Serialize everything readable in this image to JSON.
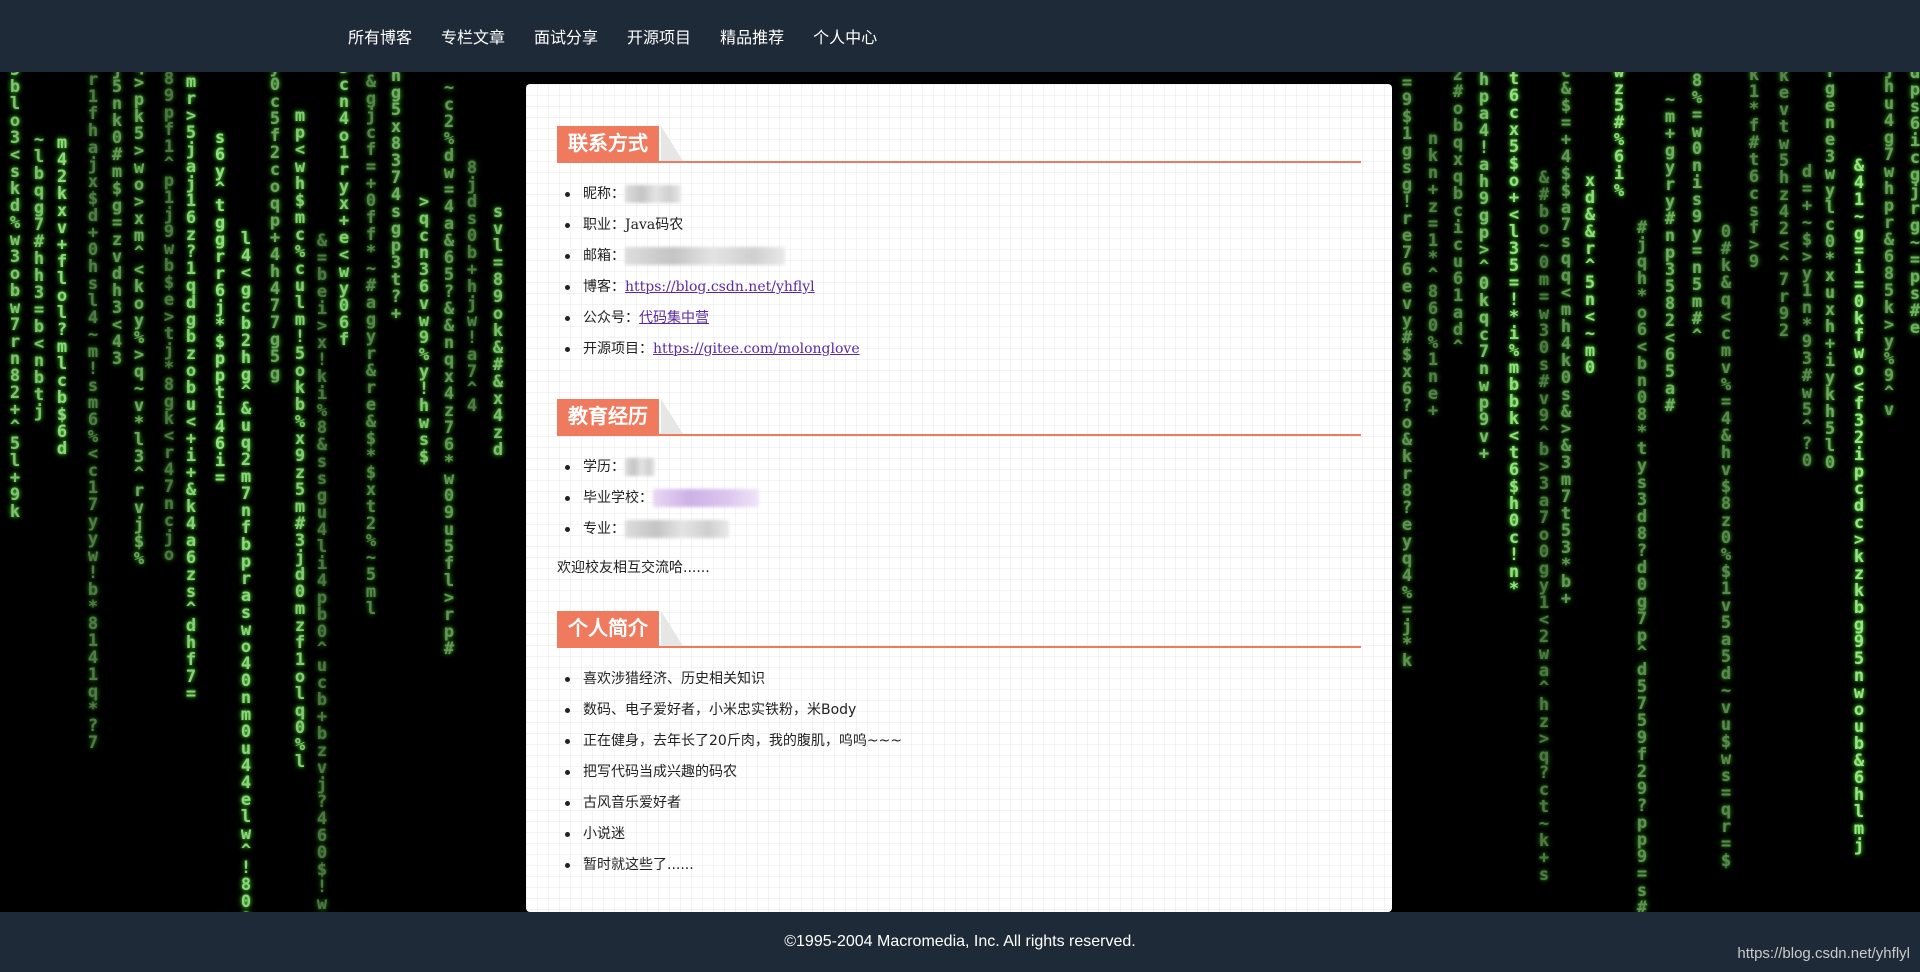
{
  "nav": {
    "items": [
      {
        "label": "所有博客"
      },
      {
        "label": "专栏文章"
      },
      {
        "label": "面试分享"
      },
      {
        "label": "开源项目"
      },
      {
        "label": "精品推荐"
      },
      {
        "label": "个人中心"
      }
    ]
  },
  "contact": {
    "title": "联系方式",
    "nickname_label": "昵称：",
    "job_label": "职业：",
    "job_value": "Java码农",
    "email_label": "邮箱：",
    "blog_label": "博客：",
    "blog_url": "https://blog.csdn.net/yhflyl",
    "wechat_label": "公众号：",
    "wechat_value": "代码集中营",
    "oss_label": "开源项目：",
    "oss_url": "https://gitee.com/molonglove"
  },
  "education": {
    "title": "教育经历",
    "degree_label": "学历：",
    "school_label": "毕业学校：",
    "major_label": "专业：",
    "note": "欢迎校友相互交流哈......"
  },
  "profile": {
    "title": "个人简介",
    "items": [
      "喜欢涉猎经济、历史相关知识",
      "数码、电子爱好者，小米忠实铁粉，米Body",
      "正在健身，去年长了20斤肉，我的腹肌，呜呜~~~",
      "把写代码当成兴趣的码农",
      "古风音乐爱好者",
      "小说迷",
      "暂时就这些了......"
    ]
  },
  "footer": {
    "copyright": "©1995-2004 Macromedia, Inc. All rights reserved."
  },
  "watermark": "https://blog.csdn.net/yhflyl",
  "colors": {
    "nav_bg": "#1f2a38",
    "accent": "#ef7a5e",
    "link": "#5b2aa0",
    "rain": "#9be58a"
  }
}
